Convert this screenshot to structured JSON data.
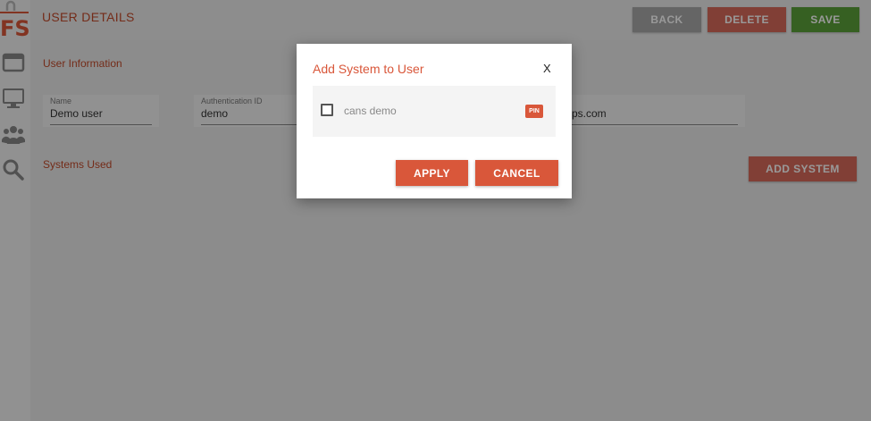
{
  "brand": {
    "logo_text": "FS",
    "color": "#d9573a"
  },
  "sidebar": {
    "items": [
      {
        "icon": "window-icon"
      },
      {
        "icon": "monitor-icon"
      },
      {
        "icon": "users-icon"
      },
      {
        "icon": "search-icon"
      }
    ]
  },
  "header": {
    "title": "USER DETAILS",
    "back_label": "BACK",
    "delete_label": "DELETE",
    "save_label": "SAVE"
  },
  "user_info": {
    "section_label": "User Information",
    "name": {
      "label": "Name",
      "value": "Demo user"
    },
    "auth_id": {
      "label": "Authentication ID",
      "value": "demo"
    },
    "email": {
      "value": "ps.com"
    }
  },
  "systems": {
    "section_label": "Systems Used",
    "add_label": "ADD SYSTEM"
  },
  "modal": {
    "title": "Add System to User",
    "close_label": "X",
    "options": [
      {
        "label": "cans demo",
        "checked": false,
        "badge": "PIN"
      }
    ],
    "apply_label": "APPLY",
    "cancel_label": "CANCEL"
  },
  "colors": {
    "accent": "#d9573a",
    "save_green": "#5ba03a",
    "back_gray": "#a8a8a8"
  }
}
